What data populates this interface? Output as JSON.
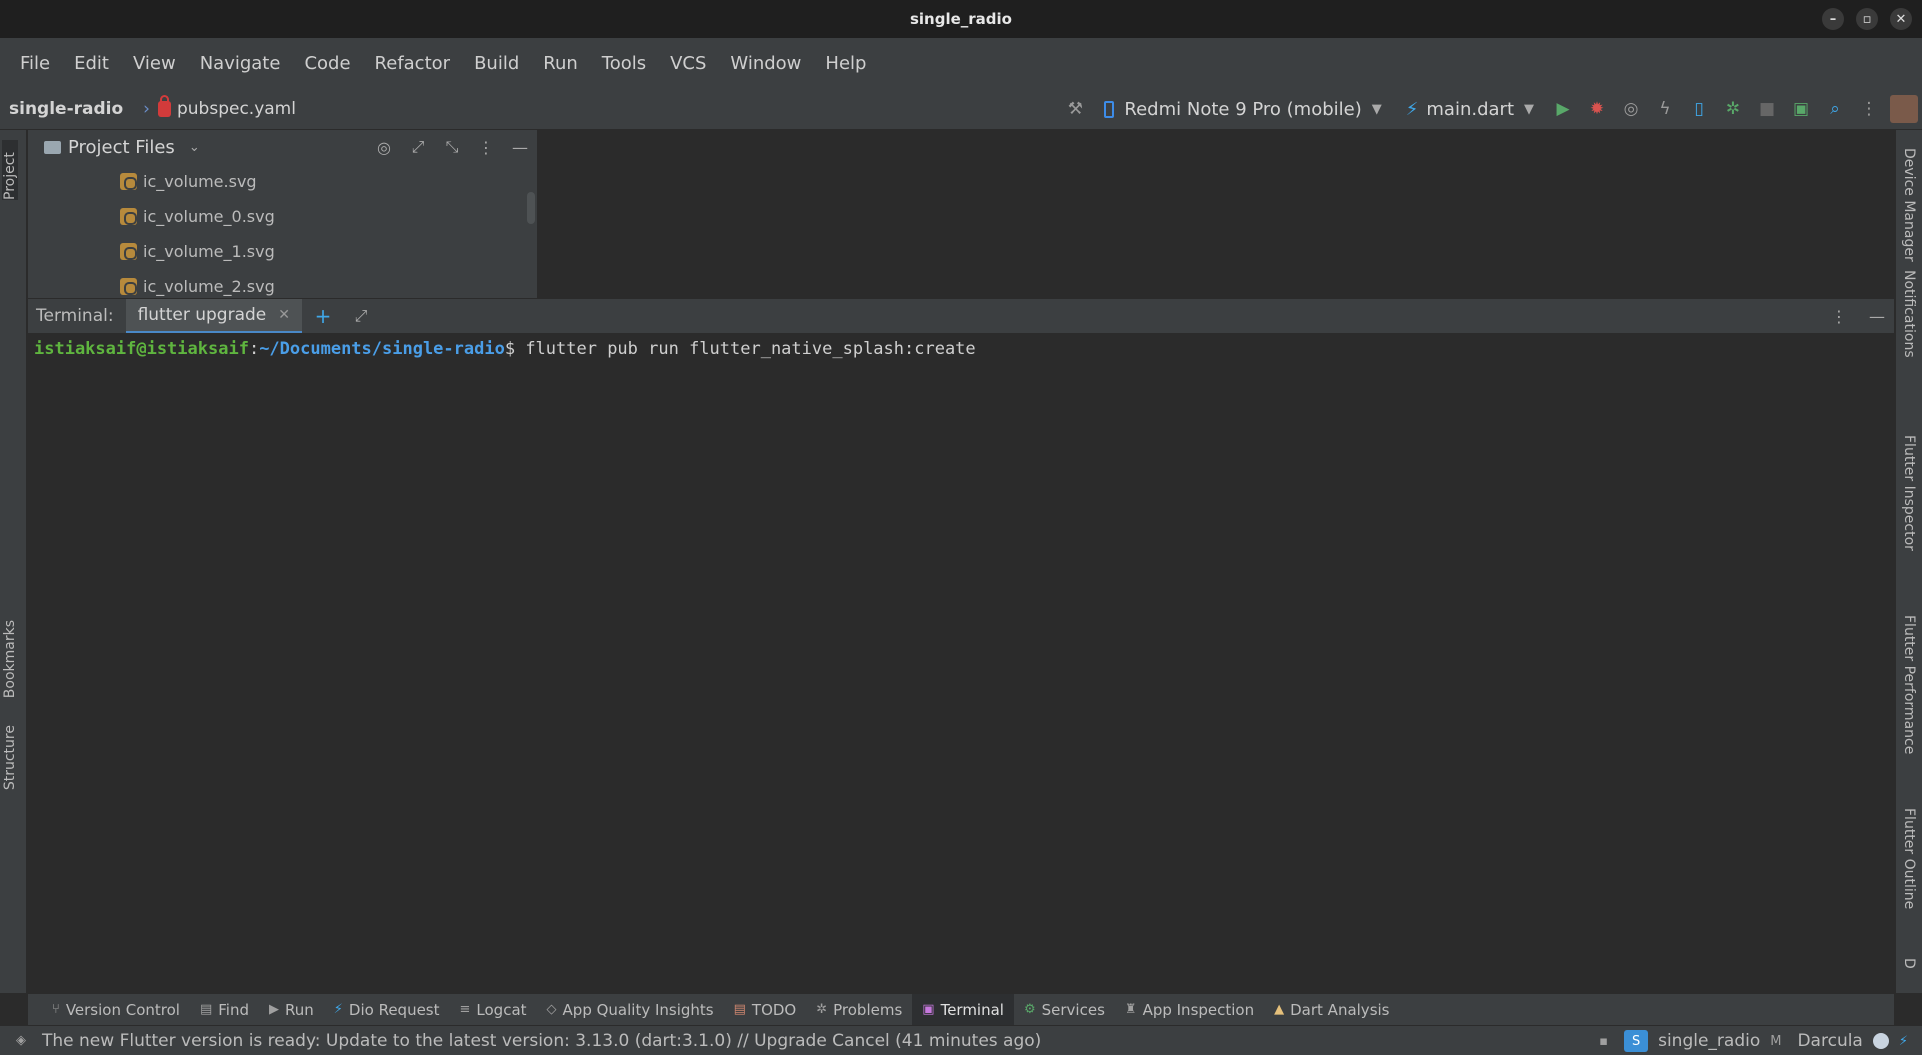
{
  "window": {
    "title": "single_radio"
  },
  "menu": [
    "File",
    "Edit",
    "View",
    "Navigate",
    "Code",
    "Refactor",
    "Build",
    "Run",
    "Tools",
    "VCS",
    "Window",
    "Help"
  ],
  "breadcrumb": {
    "project": "single-radio",
    "file": "pubspec.yaml"
  },
  "toolbar": {
    "device": "Redmi Note 9 Pro (mobile)",
    "run_config": "main.dart"
  },
  "left_stripe": {
    "project": "Project",
    "bookmarks": "Bookmarks",
    "structure": "Structure"
  },
  "right_stripe": [
    "Device Manager",
    "Notifications",
    "Flutter Inspector",
    "Flutter Performance",
    "Flutter Outline",
    "D"
  ],
  "project_panel": {
    "title": "Project Files",
    "files": [
      "ic_volume.svg",
      "ic_volume_0.svg",
      "ic_volume_1.svg",
      "ic_volume_2.svg"
    ]
  },
  "terminal": {
    "label": "Terminal:",
    "tab": "flutter upgrade",
    "prompt_user": "istiaksaif@istiaksaif",
    "prompt_sep": ":",
    "prompt_path": "~/Documents/single-radio",
    "prompt_sign": "$ ",
    "command": "flutter pub run flutter_native_splash:create"
  },
  "bottom_tabs": [
    "Version Control",
    "Find",
    "Run",
    "Dio Request",
    "Logcat",
    "App Quality Insights",
    "TODO",
    "Problems",
    "Terminal",
    "Services",
    "App Inspection",
    "Dart Analysis"
  ],
  "status": {
    "message": "The new Flutter version is ready: Update to the latest version: 3.13.0  (dart:3.1.0) // Upgrade   Cancel (41 minutes ago)",
    "project_badge": "S",
    "project": "single_radio",
    "theme": "Darcula"
  }
}
